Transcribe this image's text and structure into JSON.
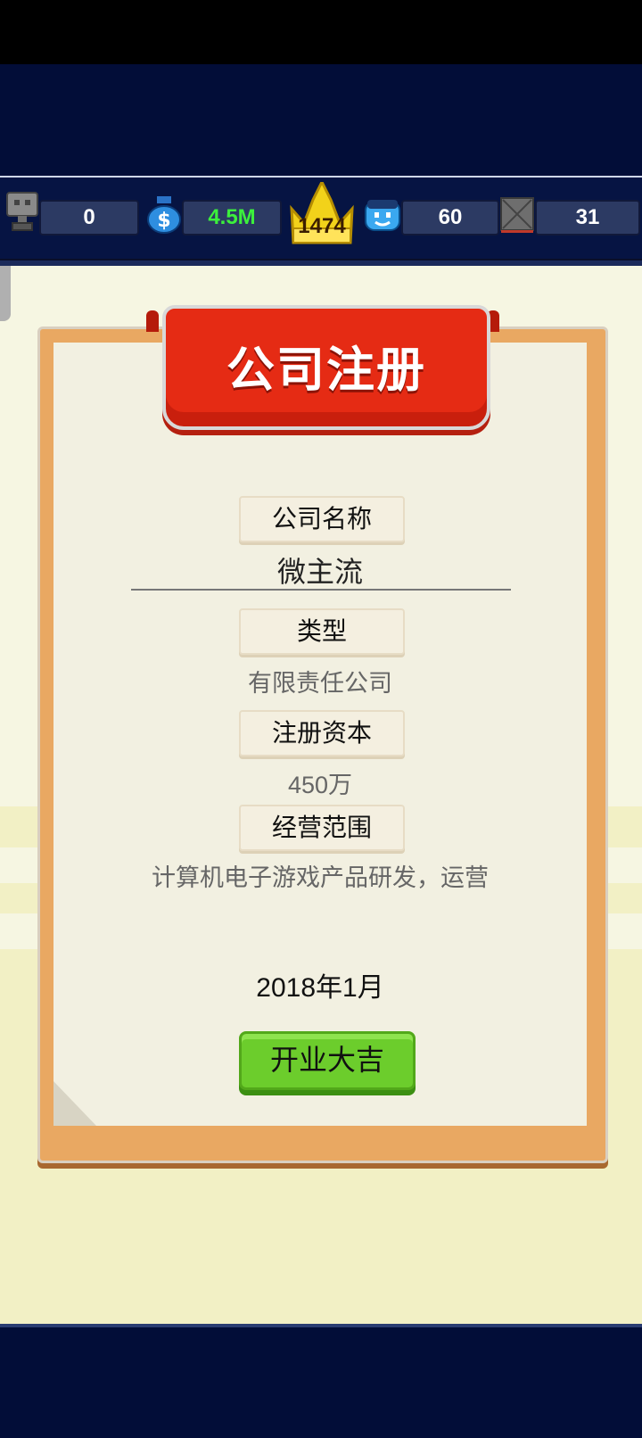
{
  "hud": {
    "coins": "0",
    "money": "4.5M",
    "level": "1474",
    "staff": "60",
    "items": "31"
  },
  "dialog": {
    "title": "公司注册",
    "name_label": "公司名称",
    "name_value": "微主流",
    "type_label": "类型",
    "type_value": "有限责任公司",
    "capital_label": "注册资本",
    "capital_value": "450万",
    "scope_label": "经营范围",
    "scope_value": "计算机电子游戏产品研发，运营",
    "date": "2018年1月",
    "confirm_button": "开业大吉"
  },
  "colors": {
    "navy": "#020d38",
    "banner_red": "#e52b14",
    "card_orange": "#e9a862",
    "button_green": "#6ccd2c",
    "money_green": "#3cf03c"
  },
  "icons": [
    "trophy-icon",
    "money-bag-icon",
    "crown-icon",
    "employee-face-icon",
    "crossed-box-icon"
  ]
}
